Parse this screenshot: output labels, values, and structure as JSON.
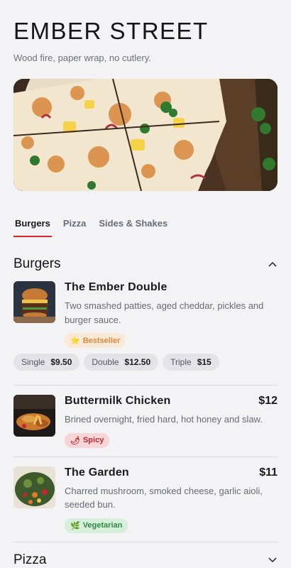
{
  "restaurant": {
    "name": "EMBER STREET",
    "tagline": "Wood fire, paper wrap, no cutlery."
  },
  "tabs": [
    {
      "label": "Burgers",
      "active": true
    },
    {
      "label": "Pizza",
      "active": false
    },
    {
      "label": "Sides & Shakes",
      "active": false
    }
  ],
  "sections": {
    "burgers": {
      "title": "Burgers",
      "items": [
        {
          "name": "The Ember Double",
          "desc": "Two smashed patties, aged cheddar, pickles and burger sauce.",
          "badge": "Bestseller",
          "badge_icon": "star-icon",
          "sizes": [
            {
              "label": "Single",
              "price": "$9.50"
            },
            {
              "label": "Double",
              "price": "$12.50"
            },
            {
              "label": "Triple",
              "price": "$15"
            }
          ]
        },
        {
          "name": "Buttermilk Chicken",
          "price": "$12",
          "desc": "Brined overnight, fried hard, hot honey and slaw.",
          "badge": "Spicy",
          "badge_icon": "chili-icon"
        },
        {
          "name": "The Garden",
          "price": "$11",
          "desc": "Charred mushroom, smoked cheese, garlic aioli, seeded bun.",
          "badge": "Vegetarian",
          "badge_icon": "leaf-icon"
        }
      ]
    },
    "pizza": {
      "title": "Pizza"
    }
  },
  "colors": {
    "accent": "#d8262f",
    "background": "#f3f3f6"
  }
}
